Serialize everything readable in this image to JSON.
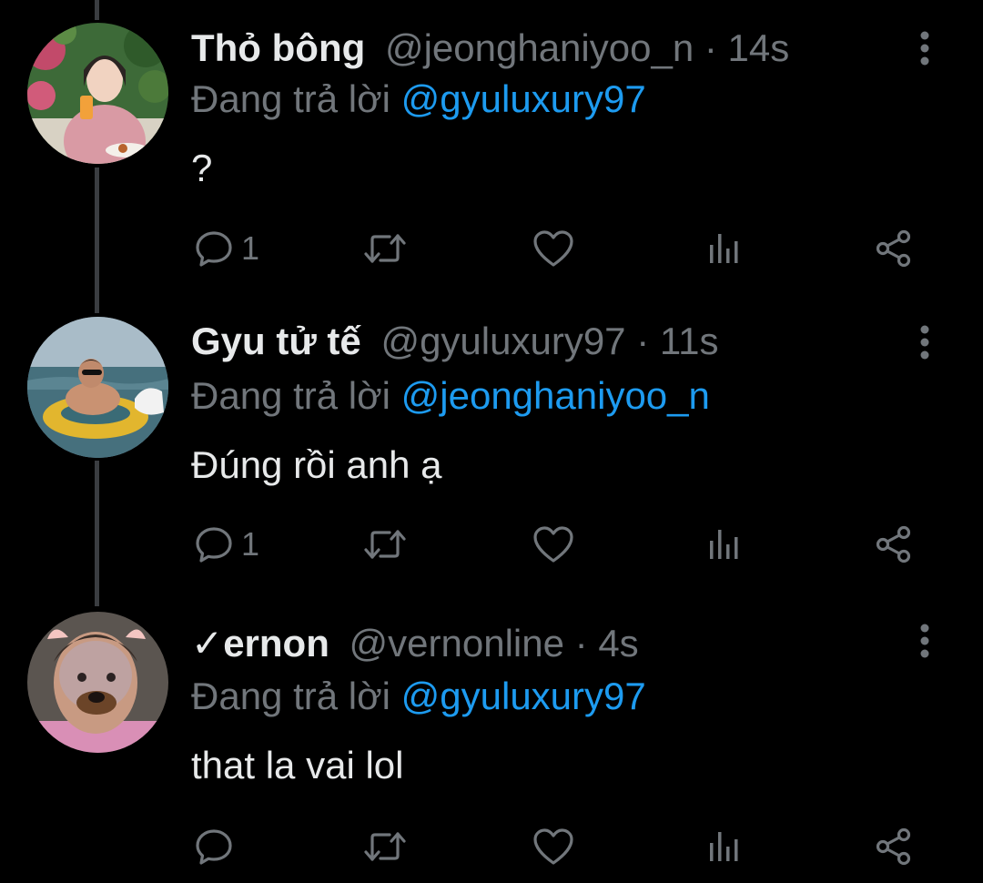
{
  "replies": [
    {
      "display_name": "Thỏ bông",
      "handle": "@jeonghaniyoo_n",
      "separator": "·",
      "time": "14s",
      "reply_prefix": "Đang trả lời",
      "reply_to": "@gyuluxury97",
      "text": "?",
      "reply_count": "1"
    },
    {
      "display_name": "Gyu tử tế",
      "handle": "@gyuluxury97",
      "separator": "·",
      "time": "11s",
      "reply_prefix": "Đang trả lời",
      "reply_to": "@jeonghaniyoo_n",
      "text": "Đúng rồi anh ạ",
      "reply_count": "1"
    },
    {
      "display_name": "✓ernon",
      "handle": "@vernonline",
      "separator": "·",
      "time": "4s",
      "reply_prefix": "Đang trả lời",
      "reply_to": "@gyuluxury97",
      "text": "that la vai lol",
      "reply_count": ""
    }
  ],
  "icons": {
    "reply": "speech-bubble-icon",
    "retweet": "retweet-icon",
    "like": "heart-icon",
    "views": "bar-chart-icon",
    "share": "share-icon",
    "more": "more-vertical-icon"
  },
  "colors": {
    "background": "#000000",
    "text": "#e7e9ea",
    "muted": "#71767b",
    "link": "#1d9bf0",
    "thread_line": "#3a3d41"
  }
}
